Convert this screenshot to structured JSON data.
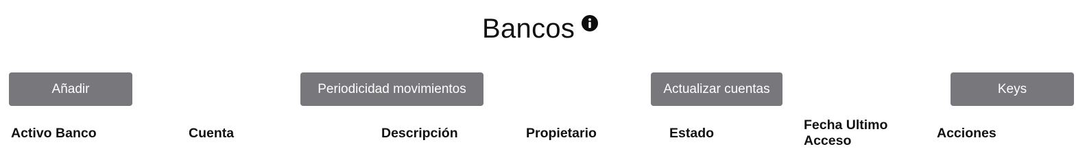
{
  "header": {
    "title": "Bancos",
    "info_icon": "info-icon"
  },
  "toolbar": {
    "add_label": "Añadir",
    "periodicity_label": "Periodicidad movimientos",
    "update_accounts_label": "Actualizar cuentas",
    "keys_label": "Keys"
  },
  "table": {
    "columns": [
      "Activo Banco",
      "Cuenta",
      "Descripción",
      "Propietario",
      "Estado",
      "Fecha Ultimo Acceso",
      "Acciones"
    ]
  },
  "colors": {
    "button_bg": "#78777c",
    "button_text": "#ffffff",
    "text": "#111111"
  }
}
